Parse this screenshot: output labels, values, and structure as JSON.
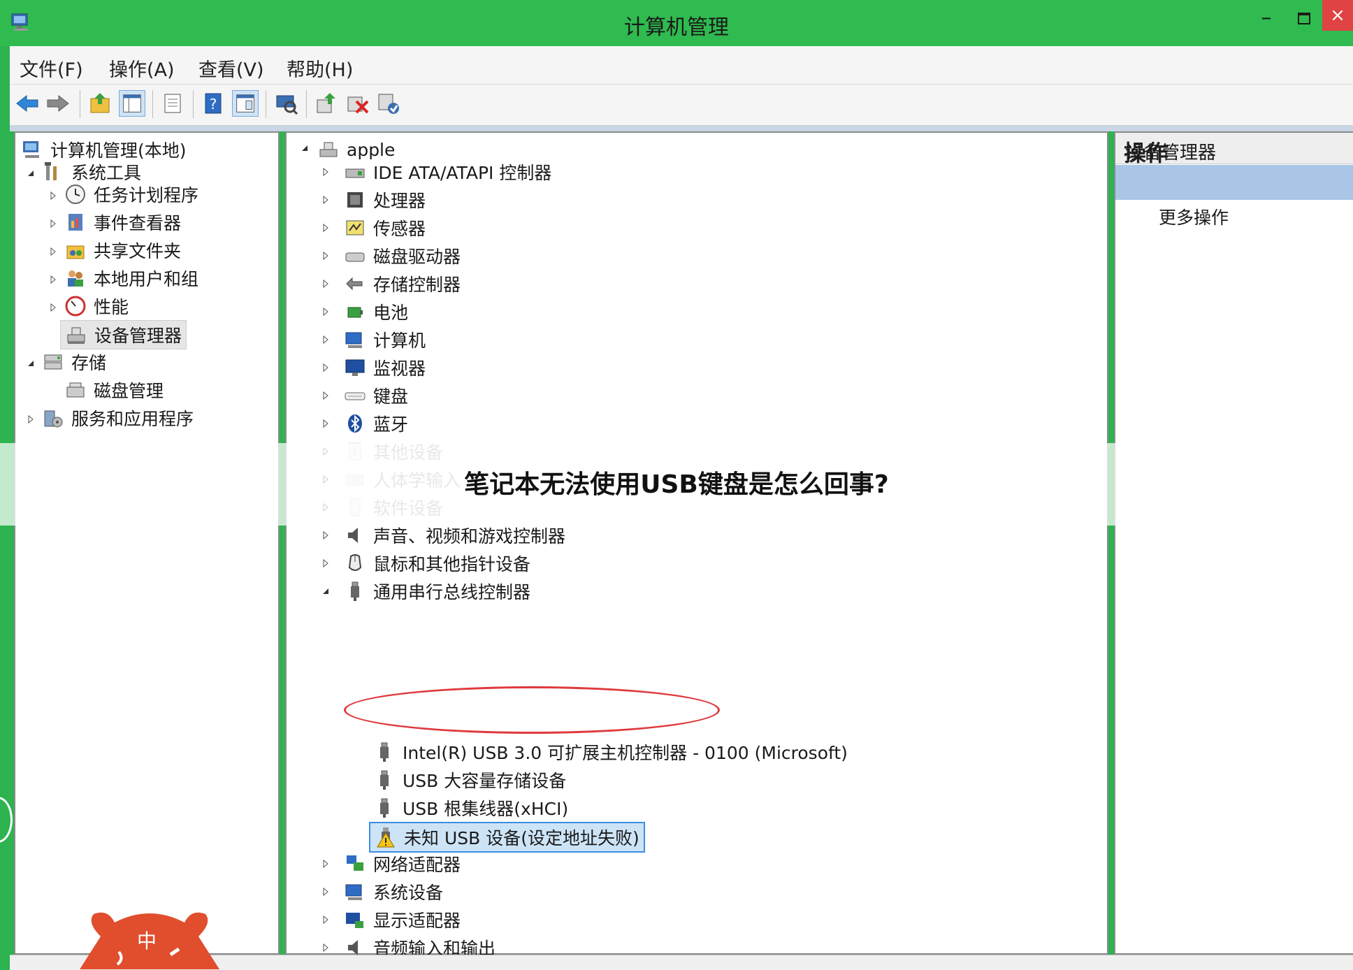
{
  "window": {
    "title": "计算机管理",
    "minimize": "–",
    "close": "×"
  },
  "menu": [
    {
      "label": "文件(F)"
    },
    {
      "label": "操作(A)"
    },
    {
      "label": "查看(V)"
    },
    {
      "label": "帮助(H)"
    }
  ],
  "toolbar_icons": [
    "back-arrow-icon",
    "forward-arrow-icon",
    "up-folder-icon",
    "show-tree-icon",
    "properties-icon",
    "help-icon",
    "view-icon",
    "scan-hardware-icon",
    "update-driver-icon",
    "uninstall-icon",
    "enable-device-icon"
  ],
  "left_tree": {
    "root": "计算机管理(本地)",
    "system_tools": "系统工具",
    "task_scheduler": "任务计划程序",
    "event_viewer": "事件查看器",
    "shared_folders": "共享文件夹",
    "local_users": "本地用户和组",
    "performance": "性能",
    "device_manager": "设备管理器",
    "storage": "存储",
    "disk_management": "磁盘管理",
    "services_apps": "服务和应用程序"
  },
  "device_tree": {
    "root": "apple",
    "categories": [
      "IDE ATA/ATAPI 控制器",
      "处理器",
      "传感器",
      "磁盘驱动器",
      "存储控制器",
      "电池",
      "计算机",
      "监视器",
      "键盘",
      "蓝牙",
      "其他设备",
      "人体学输入",
      "软件设备",
      "声音、视频和游戏控制器",
      "鼠标和其他指针设备",
      "通用串行总线控制器"
    ],
    "usb_children": [
      "Intel(R) USB 3.0 可扩展主机控制器 - 0100 (Microsoft)",
      "USB 大容量存储设备",
      "USB 根集线器(xHCI)",
      "未知 USB 设备(设定地址失败)"
    ],
    "after_usb": [
      "网络适配器",
      "系统设备",
      "显示适配器",
      "音频输入和输出"
    ]
  },
  "actions": {
    "title": "操作",
    "section": "设备管理器",
    "more": "更多操作"
  },
  "overlay": {
    "headline": "笔记本无法使用USB键盘是怎么回事?"
  },
  "logo": {
    "text": "中"
  }
}
